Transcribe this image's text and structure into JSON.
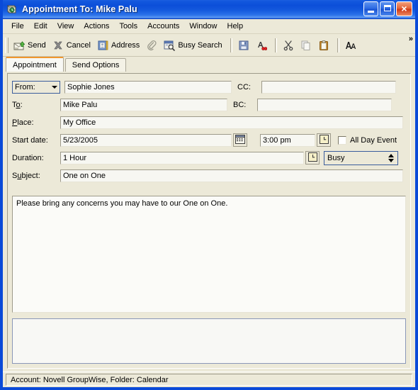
{
  "window": {
    "title": "Appointment To: Mike Palu",
    "icon": "appointment-book-icon",
    "minimize_label": "Minimize",
    "maximize_label": "Maximize",
    "close_label": "Close"
  },
  "menu": {
    "items": [
      {
        "label": "File"
      },
      {
        "label": "Edit"
      },
      {
        "label": "View"
      },
      {
        "label": "Actions"
      },
      {
        "label": "Tools"
      },
      {
        "label": "Accounts"
      },
      {
        "label": "Window"
      },
      {
        "label": "Help"
      }
    ]
  },
  "toolbar": {
    "send_label": "Send",
    "send_icon": "send-envelope-icon",
    "cancel_label": "Cancel",
    "cancel_icon": "cancel-x-icon",
    "address_label": "Address",
    "address_icon": "address-book-icon",
    "attach_icon": "paperclip-icon",
    "busy_search_label": "Busy Search",
    "busy_search_icon": "busy-search-icon",
    "save_icon": "save-floppy-icon",
    "spellcheck_icon": "spell-check-icon",
    "cut_icon": "scissors-icon",
    "copy_icon": "copy-pages-icon",
    "paste_icon": "clipboard-paste-icon",
    "font_icon": "font-aa-icon",
    "overflow_label": "»"
  },
  "tabs": [
    {
      "label": "Appointment",
      "active": true
    },
    {
      "label": "Send Options",
      "active": false
    }
  ],
  "form": {
    "from_label": "From:",
    "from_value": "Sophie Jones",
    "to_label": "To:",
    "to_value": "Mike Palu",
    "cc_label": "CC:",
    "cc_value": "",
    "bc_label": "BC:",
    "bc_value": "",
    "place_label": "Place:",
    "place_value": "My Office",
    "start_date_label": "Start date:",
    "start_date_value": "5/23/2005",
    "calendar_icon": "calendar-picker-icon",
    "time_value": "3:00 pm",
    "time_clock_icon": "clock-picker-icon",
    "all_day_label": "All Day Event",
    "all_day_checked": false,
    "duration_label": "Duration:",
    "duration_value": "1 Hour",
    "duration_clock_icon": "clock-picker-icon",
    "show_as_value": "Busy",
    "subject_label": "Subject:",
    "subject_value": "One on One",
    "message_body": "Please bring any concerns you may have to our One on One."
  },
  "statusbar": {
    "text": "Account: Novell GroupWise,  Folder: Calendar"
  },
  "colors": {
    "titlebar_blue": "#0c4fd9",
    "window_border": "#0a4ad8",
    "face": "#ece9d8",
    "active_tab_accent": "#f0962d",
    "field_bg": "#f7f7f2"
  }
}
